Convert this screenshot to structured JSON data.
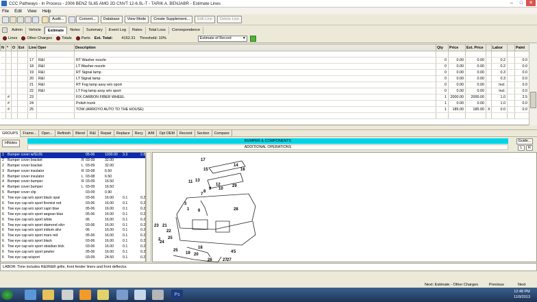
{
  "window": {
    "title": "CCC Pathways - In Process - 2006 BENZ SL65 AMG 2D CNVT 12-6.0L-T - TARIK A. BENJABR - Estimate Lines",
    "min": "–",
    "max": "□",
    "close": "✕"
  },
  "menu": [
    "File",
    "Edit",
    "View",
    "Help"
  ],
  "toolbar": {
    "buttons": [
      {
        "label": "Audit...",
        "enabled": true
      },
      {
        "label": "Convert...",
        "enabled": true
      },
      {
        "label": "Database",
        "enabled": true
      },
      {
        "label": "View Mode",
        "enabled": true
      },
      {
        "label": "Create Supplement...",
        "enabled": true
      },
      {
        "label": "Edit Line",
        "enabled": false
      },
      {
        "label": "Delete Line",
        "enabled": false
      }
    ]
  },
  "tabs": [
    {
      "label": "Admin"
    },
    {
      "label": "Vehicle"
    },
    {
      "label": "Estimate",
      "active": true
    },
    {
      "label": "Notes"
    },
    {
      "label": "Summary"
    },
    {
      "label": "Event Log"
    },
    {
      "label": "Rates"
    },
    {
      "label": "Total Loss"
    },
    {
      "label": "Correspondence"
    }
  ],
  "viewbar": {
    "radios": [
      "Lines",
      "Other Charges",
      "Totals",
      "Parts"
    ],
    "est_total_label": "Est. Total:",
    "est_total": "4152.31",
    "threshold": "Threshold: 10%",
    "select_value": "Estimate of Record"
  },
  "grid": {
    "columns": [
      "N",
      "*",
      "O",
      "Est",
      "Line",
      "Oper",
      "Description",
      "Qty",
      "Price",
      "Ext. Price",
      "",
      "Labor",
      "",
      "Paint"
    ],
    "rows": [
      {
        "n": "",
        "s": "",
        "o": "",
        "est": "",
        "line": "",
        "oper": "",
        "desc": "",
        "qty": "",
        "price": "",
        "ext": "",
        "x": "",
        "labor": "",
        "lf": "",
        "paint": ""
      },
      {
        "n": "",
        "s": "",
        "o": "",
        "est": "",
        "line": "17",
        "oper": "R&I",
        "desc": "RT Washer nozzle",
        "qty": "0",
        "price": "0.00",
        "ext": "0.00",
        "x": "",
        "labor": "0.2",
        "lf": "",
        "paint": "0.0"
      },
      {
        "n": "",
        "s": "",
        "o": "",
        "est": "",
        "line": "18",
        "oper": "R&I",
        "desc": "LT Washer nozzle",
        "qty": "0",
        "price": "0.00",
        "ext": "0.00",
        "x": "",
        "labor": "0.2",
        "lf": "",
        "paint": "0.0"
      },
      {
        "n": "",
        "s": "",
        "o": "",
        "est": "",
        "line": "19",
        "oper": "R&I",
        "desc": "RT Signal lamp",
        "qty": "0",
        "price": "0.00",
        "ext": "0.00",
        "x": "",
        "labor": "0.3",
        "lf": "",
        "paint": "0.0"
      },
      {
        "n": "",
        "s": "",
        "o": "",
        "est": "",
        "line": "20",
        "oper": "R&I",
        "desc": "LT Signal lamp",
        "qty": "0",
        "price": "0.00",
        "ext": "0.00",
        "x": "",
        "labor": "0.3",
        "lf": "",
        "paint": "0.0"
      },
      {
        "n": "",
        "s": "",
        "o": "",
        "est": "",
        "line": "21",
        "oper": "R&I",
        "desc": "RT Fog lamp assy w/o sport",
        "qty": "0",
        "price": "0.00",
        "ext": "0.00",
        "x": "",
        "labor": "Incl.",
        "lf": "",
        "paint": "0.0"
      },
      {
        "n": "",
        "s": "",
        "o": "",
        "est": "",
        "line": "22",
        "oper": "R&I",
        "desc": "LT Fog lamp assy w/o sport",
        "qty": "0",
        "price": "0.00",
        "ext": "0.00",
        "x": "",
        "labor": "Incl.",
        "lf": "",
        "paint": "0.0"
      },
      {
        "n": "",
        "s": "#",
        "o": "",
        "est": "",
        "line": "23",
        "oper": "",
        "desc": "FIX CARBON FIBER WHEEL",
        "qty": "1",
        "price": "2000.00",
        "ext": "2000.00",
        "x": "",
        "labor": "1.0",
        "lf": "",
        "paint": "2.5"
      },
      {
        "n": "",
        "s": "#",
        "o": "",
        "est": "",
        "line": "24",
        "oper": "",
        "desc": "Polish trunk",
        "qty": "1",
        "price": "0.00",
        "ext": "0.00",
        "x": "",
        "labor": "1.0",
        "lf": "",
        "paint": "0.0"
      },
      {
        "n": "",
        "s": "#",
        "o": "",
        "est": "",
        "line": "25",
        "oper": "",
        "desc": "TOW (ARROYO AUTO TO THE HOUSE)",
        "qty": "1",
        "price": "185.00",
        "ext": "185.00",
        "x": "X",
        "labor": "0.0",
        "lf": "",
        "paint": "0.0"
      }
    ]
  },
  "groupbar": [
    "GROUPS",
    "Frame...",
    "Oper...",
    "Refinish",
    "Blend",
    "R&I",
    "Repair",
    "Replace",
    "Recy",
    "A/M",
    "Opt OEM",
    "Recond",
    "Section",
    "Compare"
  ],
  "hnotes": "HNotes",
  "section_title": "BUMPER & COMPONENTS",
  "section_sub": "ADDITIONAL OPERATIONS",
  "guide": "Guide...",
  "lr": [
    "L",
    "R"
  ],
  "parts": [
    [
      "1",
      "Bumper cover w/SL65",
      "",
      "05-06",
      "1930.00",
      "3.3",
      "2.8"
    ],
    [
      "2",
      "Bumper cover bracket",
      "R",
      "03-09",
      "32.00",
      "",
      ""
    ],
    [
      "2",
      "Bumper cover bracket",
      "L",
      "03-09",
      "32.00",
      "",
      ""
    ],
    [
      "3",
      "Bumper cover insulator",
      "R",
      "03-08",
      "6.50",
      "",
      ""
    ],
    [
      "3",
      "Bumper cover insulator",
      "L",
      "03-08",
      "6.50",
      "",
      ""
    ],
    [
      "4",
      "Bumper cover bumper",
      "R",
      "03-09",
      "16.50",
      "",
      ""
    ],
    [
      "4",
      "Bumper cover bumper",
      "L",
      "03-09",
      "16.50",
      "",
      ""
    ],
    [
      "5",
      "Bumper cover clip",
      "",
      "03-09",
      "0.90",
      "",
      ""
    ],
    [
      "6",
      "Tow eye cap w/o sport black opal",
      "",
      "03-06",
      "16.00",
      "0.1",
      "0.2"
    ],
    [
      "6",
      "Tow eye cap w/o sport firemist red",
      "",
      "03-06",
      "16.00",
      "0.1",
      "0.2"
    ],
    [
      "6",
      "Tow eye cap w/o sport capri blue",
      "",
      "05-06",
      "16.00",
      "0.1",
      "0.2"
    ],
    [
      "6",
      "Tow eye cap w/o sport aegean blue",
      "",
      "05-06",
      "16.00",
      "0.1",
      "0.2"
    ],
    [
      "6",
      "Tow eye cap w/o sport white",
      "",
      "06",
      "16.00",
      "0.1",
      "0.2"
    ],
    [
      "6",
      "Tow eye cap w/o sport diamond silvr",
      "",
      "03-06",
      "16.00",
      "0.1",
      "0.2"
    ],
    [
      "6",
      "Tow eye cap w/o sport iridium silvr",
      "",
      "06",
      "16.00",
      "0.1",
      "0.2"
    ],
    [
      "6",
      "Tow eye cap w/o sport mars red",
      "",
      "05-06",
      "16.00",
      "0.1",
      "0.2"
    ],
    [
      "6",
      "Tow eye cap w/o sport black",
      "",
      "03-06",
      "16.00",
      "0.1",
      "0.2"
    ],
    [
      "6",
      "Tow eye cap w/o sport obsidian blck",
      "",
      "03-06",
      "16.00",
      "0.1",
      "0.2"
    ],
    [
      "6",
      "Tow eye cap w/o sport pewter",
      "",
      "05-06",
      "16.00",
      "0.1",
      "0.2"
    ],
    [
      "6",
      "Tow eye cap w/sport",
      "",
      "03-09",
      "24.50",
      "0.1",
      "0.2"
    ]
  ],
  "diagram_labels": [
    "17",
    "15",
    "14",
    "16",
    "13",
    "11",
    "12",
    "10",
    "29",
    "9",
    "8",
    "7",
    "3",
    "1",
    "6",
    "28",
    "23",
    "21",
    "22",
    "24",
    "2",
    "25",
    "4",
    "19",
    "20",
    "27",
    "26",
    "18",
    "5",
    "27",
    "25"
  ],
  "labor_note": "LABOR: Time includes R&I/R&R grille, front fender liners and front deflector.",
  "nav": {
    "next_label": "Next: Estimate - Other Charges",
    "previous": "Previous",
    "next": "Next"
  },
  "clock": {
    "time": "12:48 PM",
    "date": "11/9/2013"
  },
  "colors": {
    "section": "#00d5e8",
    "selected": "#0b2bb0",
    "radio": "#8b1a1a"
  }
}
